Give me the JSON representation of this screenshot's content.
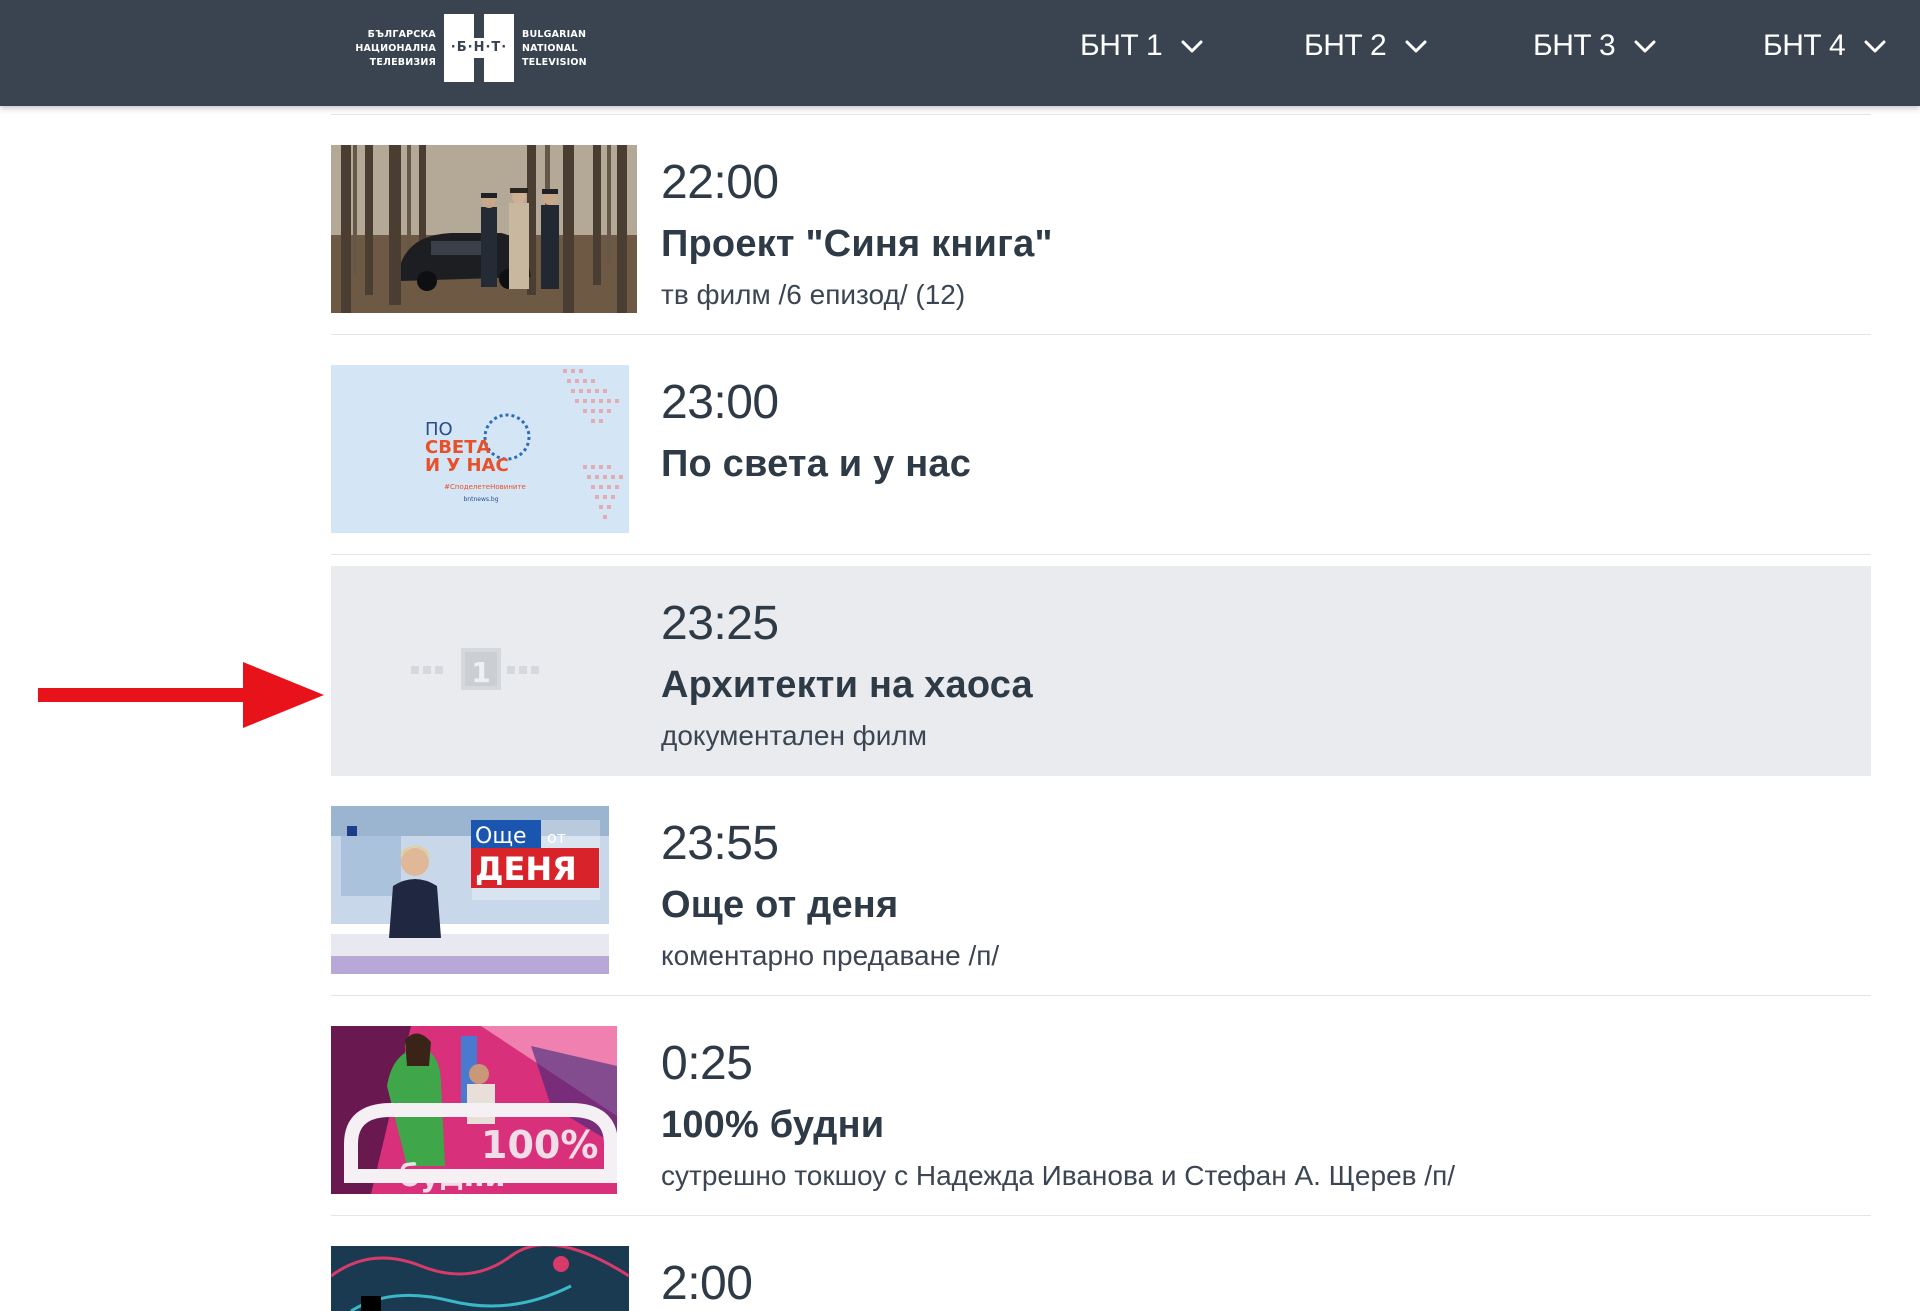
{
  "logo": {
    "left_lines": [
      "БЪЛГАРСКА",
      "НАЦИОНАЛНА",
      "ТЕЛЕВИЗИЯ"
    ],
    "mark": "·Б·Н·Т·",
    "right_lines": [
      "BULGARIAN",
      "NATIONAL",
      "TELEVISION"
    ]
  },
  "nav": [
    {
      "label": "БНТ 1"
    },
    {
      "label": "БНТ 2"
    },
    {
      "label": "БНТ 3"
    },
    {
      "label": "БНТ 4"
    }
  ],
  "schedule": [
    {
      "time": "22:00",
      "title": "Проект \"Синя книга\"",
      "description": "тв филм /6 епизод/ (12)",
      "thumb": "forest-scene"
    },
    {
      "time": "23:00",
      "title": "По света и у нас",
      "description": "",
      "thumb": "news-logo",
      "thumb_text": [
        "ПО",
        "СВЕТА",
        "И У НАС"
      ],
      "thumb_tag": "#СподелетеНовините",
      "thumb_site": "bntnews.bg"
    },
    {
      "time": "23:25",
      "title": "Архитекти на хаоса",
      "description": "документален филм",
      "thumb": "channel-placeholder",
      "thumb_text": "1"
    },
    {
      "time": "23:55",
      "title": "Още от деня",
      "description": "коментарно предаване /п/",
      "thumb": "studio-host",
      "thumb_text": [
        "Още",
        "от",
        "ДЕНЯ"
      ]
    },
    {
      "time": "0:25",
      "title": "100% будни",
      "description": "сутрешно токшоу с Надежда Иванова и Стефан А. Щерев /п/",
      "thumb": "morning-show",
      "thumb_text": [
        "100%",
        "будни"
      ]
    },
    {
      "time": "2:00",
      "title": "",
      "description": "",
      "thumb": "partial-graphic"
    }
  ],
  "colors": {
    "header_bg": "#3a4450",
    "text": "#2e3a46",
    "highlight_row": "#e9ebee",
    "annotation_arrow": "#e8121b",
    "news_orange": "#e8502a",
    "deniya_red": "#d8232a"
  }
}
